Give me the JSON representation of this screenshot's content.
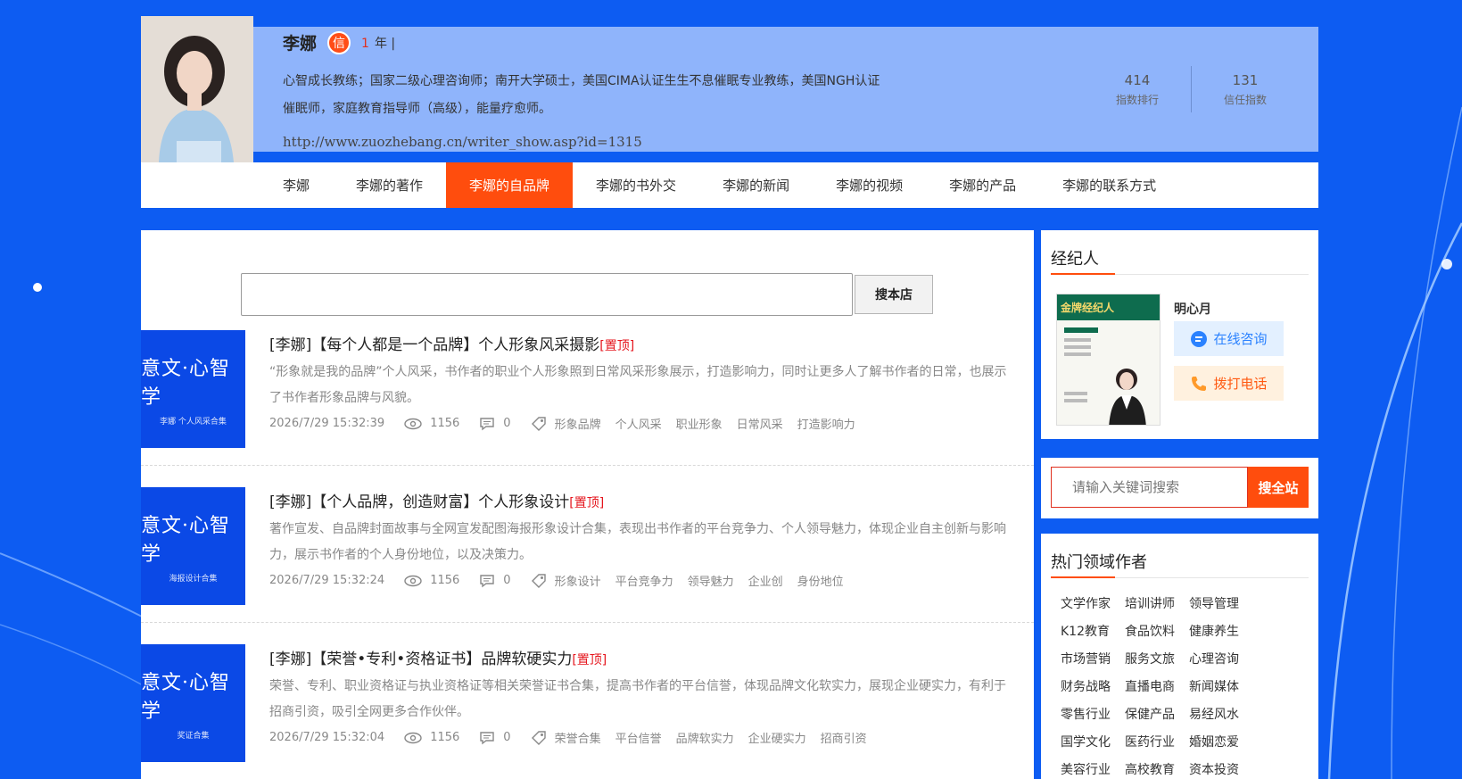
{
  "author": {
    "name": "李娜",
    "badge": "信",
    "years_num": "1",
    "years_suffix": "年 |",
    "bio": "心智成长教练；国家二级心理咨询师；南开大学硕士，美国CIMA认证生生不息催眠专业教练，美国NGH认证催眠师，家庭教育指导师（高级），能量疗愈师。",
    "url": "http://www.zuozhebang.cn/writer_show.asp?id=1315",
    "stats": [
      {
        "value": "414",
        "label": "指数排行"
      },
      {
        "value": "131",
        "label": "信任指数"
      }
    ]
  },
  "nav": {
    "items": [
      "李娜",
      "李娜的著作",
      "李娜的自品牌",
      "李娜的书外交",
      "李娜的新闻",
      "李娜的视频",
      "李娜的产品",
      "李娜的联系方式"
    ],
    "active_index": 2
  },
  "store_search": {
    "placeholder": "",
    "button": "搜本店"
  },
  "articles": [
    {
      "thumb_title": "意文·心智学",
      "thumb_sub": "李娜 个人风采合集",
      "title": "[李娜]【每个人都是一个品牌】个人形象风采摄影",
      "top_tag": "[置顶]",
      "desc": "“形象就是我的品牌”个人风采，书作者的职业个人形象照到日常风采形象展示，打造影响力，同时让更多人了解书作者的日常，也展示了书作者形象品牌与风貌。",
      "date": "2026/7/29 15:32:39",
      "views": "1156",
      "comments": "0",
      "tags": [
        "形象品牌",
        "个人风采",
        "职业形象",
        "日常风采",
        "打造影响力"
      ]
    },
    {
      "thumb_title": "意文·心智学",
      "thumb_sub": "海报设计合集",
      "title": "[李娜]【个人品牌，创造财富】个人形象设计",
      "top_tag": "[置顶]",
      "desc": "著作宣发、自品牌封面故事与全网宣发配图海报形象设计合集，表现出书作者的平台竞争力、个人领导魅力，体现企业自主创新与影响力，展示书作者的个人身份地位，以及决策力。",
      "date": "2026/7/29 15:32:24",
      "views": "1156",
      "comments": "0",
      "tags": [
        "形象设计",
        "平台竞争力",
        "领导魅力",
        "企业创",
        "身份地位"
      ]
    },
    {
      "thumb_title": "意文·心智学",
      "thumb_sub": "奖证合集",
      "title": "[李娜]【荣誉•专利•资格证书】品牌软硬实力",
      "top_tag": "[置顶]",
      "desc": "荣誉、专利、职业资格证与执业资格证等相关荣誉证书合集，提高书作者的平台信誉，体现品牌文化软实力，展现企业硬实力，有利于招商引资，吸引全网更多合作伙伴。",
      "date": "2026/7/29 15:32:04",
      "views": "1156",
      "comments": "0",
      "tags": [
        "荣誉合集",
        "平台信誉",
        "品牌软实力",
        "企业硬实力",
        "招商引资"
      ]
    }
  ],
  "agent": {
    "section_title": "经纪人",
    "cover_title": "金牌经纪人",
    "name": "明心月",
    "consult": "在线咨询",
    "call": "拨打电话"
  },
  "site_search": {
    "placeholder": "请输入关键词搜索",
    "button": "搜全站"
  },
  "hot": {
    "title": "热门领域作者",
    "items": [
      "文学作家",
      "培训讲师",
      "领导管理",
      "K12教育",
      "食品饮料",
      "健康养生",
      "市场营销",
      "服务文旅",
      "心理咨询",
      "财务战略",
      "直播电商",
      "新闻媒体",
      "零售行业",
      "保健产品",
      "易经风水",
      "国学文化",
      "医药行业",
      "婚姻恋爱",
      "美容行业",
      "高校教育",
      "资本投资"
    ]
  },
  "colors": {
    "page_bg": "#0d5cf2",
    "accent": "#ff4d0d",
    "top_tag": "#e5151d",
    "profile_band": "#8fb4fb"
  }
}
